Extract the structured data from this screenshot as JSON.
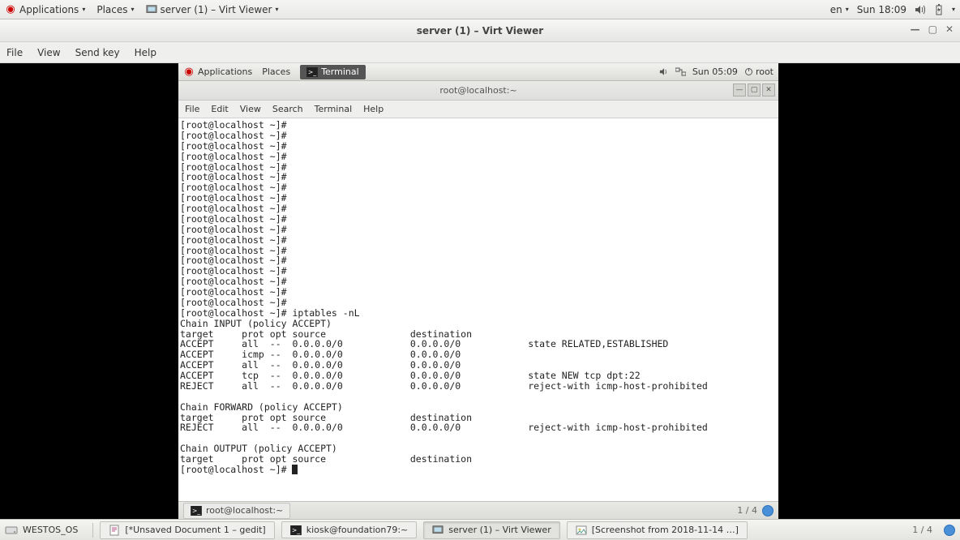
{
  "host": {
    "top": {
      "applications": "Applications",
      "places": "Places",
      "window_menu": "server (1) – Virt Viewer",
      "lang": "en",
      "clock": "Sun 18:09"
    },
    "task": {
      "westos": "WESTOS_OS",
      "items": [
        "[*Unsaved Document 1 – gedit]",
        "kiosk@foundation79:~",
        "server (1) – Virt Viewer",
        "[Screenshot from 2018-11-14 …]"
      ],
      "workspace": "1 / 4"
    }
  },
  "virt": {
    "title": "server (1) – Virt Viewer",
    "menu": [
      "File",
      "View",
      "Send key",
      "Help"
    ]
  },
  "guest": {
    "top": {
      "applications": "Applications",
      "places": "Places",
      "terminal": "Terminal",
      "clock": "Sun 05:09",
      "user": "root"
    },
    "terminal": {
      "title": "root@localhost:~",
      "menu": [
        "File",
        "Edit",
        "View",
        "Search",
        "Terminal",
        "Help"
      ],
      "lines": [
        "[root@localhost ~]#",
        "[root@localhost ~]#",
        "[root@localhost ~]#",
        "[root@localhost ~]#",
        "[root@localhost ~]#",
        "[root@localhost ~]#",
        "[root@localhost ~]#",
        "[root@localhost ~]#",
        "[root@localhost ~]#",
        "[root@localhost ~]#",
        "[root@localhost ~]#",
        "[root@localhost ~]#",
        "[root@localhost ~]#",
        "[root@localhost ~]#",
        "[root@localhost ~]#",
        "[root@localhost ~]#",
        "[root@localhost ~]#",
        "[root@localhost ~]#",
        "[root@localhost ~]# iptables -nL",
        "Chain INPUT (policy ACCEPT)",
        "target     prot opt source               destination",
        "ACCEPT     all  --  0.0.0.0/0            0.0.0.0/0            state RELATED,ESTABLISHED",
        "ACCEPT     icmp --  0.0.0.0/0            0.0.0.0/0",
        "ACCEPT     all  --  0.0.0.0/0            0.0.0.0/0",
        "ACCEPT     tcp  --  0.0.0.0/0            0.0.0.0/0            state NEW tcp dpt:22",
        "REJECT     all  --  0.0.0.0/0            0.0.0.0/0            reject-with icmp-host-prohibited",
        "",
        "Chain FORWARD (policy ACCEPT)",
        "target     prot opt source               destination",
        "REJECT     all  --  0.0.0.0/0            0.0.0.0/0            reject-with icmp-host-prohibited",
        "",
        "Chain OUTPUT (policy ACCEPT)",
        "target     prot opt source               destination"
      ],
      "prompt_last": "[root@localhost ~]# "
    },
    "task": {
      "item": "root@localhost:~",
      "workspace": "1 / 4"
    }
  }
}
